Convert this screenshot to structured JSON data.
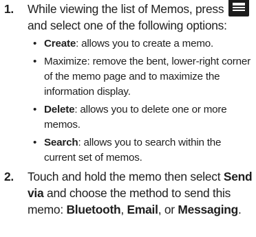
{
  "steps": [
    {
      "number": "1.",
      "intro_before_icon": "While viewing the list of Memos, press",
      "intro_after_icon": "and select one of the following options:"
    },
    {
      "number": "2.",
      "text_1": "Touch and hold the memo then select ",
      "send_via": "Send via",
      "text_2": " and choose the method to send this memo: ",
      "bluetooth": "Bluetooth",
      "sep_1": ", ",
      "email": "Email",
      "sep_2": ", or ",
      "messaging": "Messaging",
      "end": "."
    }
  ],
  "options": [
    {
      "bullet": "•",
      "term": "Create",
      "description": ": allows you to create a memo."
    },
    {
      "bullet": "•",
      "term": "",
      "description": "Maximize: remove the bent, lower-right corner of the memo page and to maximize the information display."
    },
    {
      "bullet": "•",
      "term": "Delete",
      "description": ": allows you to delete one or more memos."
    },
    {
      "bullet": "•",
      "term": "Search",
      "description": ": allows you to search within the current set of memos."
    }
  ],
  "icons": {
    "menu_key": "menu-key-icon"
  },
  "colors": {
    "text": "#1e1e1e",
    "menu_key_background": "#1c1c1c"
  }
}
